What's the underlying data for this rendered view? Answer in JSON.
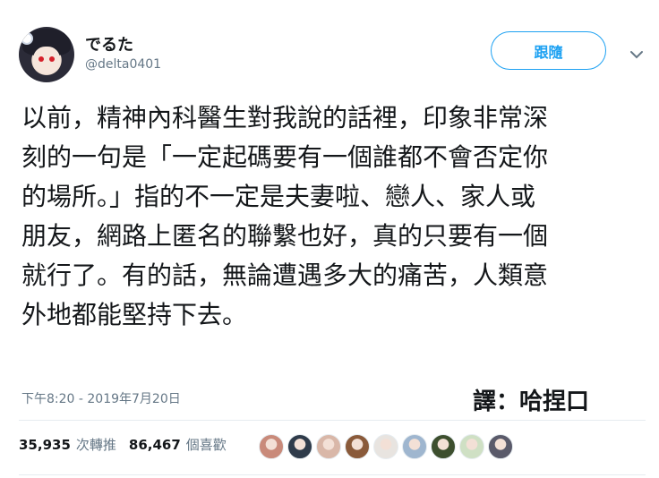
{
  "user": {
    "name": "でるた",
    "handle": "@delta0401"
  },
  "follow_button": "跟隨",
  "tweet_lines": [
    "以前，精神內科醫生對我說的話裡，印象非常深",
    "刻的一句是「一定起碼要有一個誰都不會否定你",
    "的場所。」指的不一定是夫妻啦、戀人、家人或",
    "朋友，網路上匿名的聯繫也好，真的只要有一個",
    "就行了。有的話，無論遭遇多大的痛苦，人類意",
    "外地都能堅持下去。"
  ],
  "timestamp": "下午8:20 - 2019年7月20日",
  "credit": "譯：哈捏口",
  "stats": {
    "retweets_count": "35,935",
    "retweets_label": "次轉推",
    "likes_count": "86,467",
    "likes_label": "個喜歡"
  },
  "colors": {
    "accent": "#1da1f2",
    "secondary_text": "#657786",
    "divider": "#e6ecf0"
  },
  "liker_avatars": [
    {
      "icon": "user-avatar",
      "color": "#c98a7a"
    },
    {
      "icon": "user-avatar",
      "color": "#2f3b4a"
    },
    {
      "icon": "user-avatar",
      "color": "#d9b7a8"
    },
    {
      "icon": "user-avatar",
      "color": "#8a5a3a"
    },
    {
      "icon": "user-avatar",
      "color": "#e8e4e0"
    },
    {
      "icon": "user-avatar",
      "color": "#9fb6cf"
    },
    {
      "icon": "user-avatar",
      "color": "#3d4f2e"
    },
    {
      "icon": "user-avatar",
      "color": "#cfe0c4"
    },
    {
      "icon": "user-avatar",
      "color": "#5a5a6a"
    }
  ]
}
